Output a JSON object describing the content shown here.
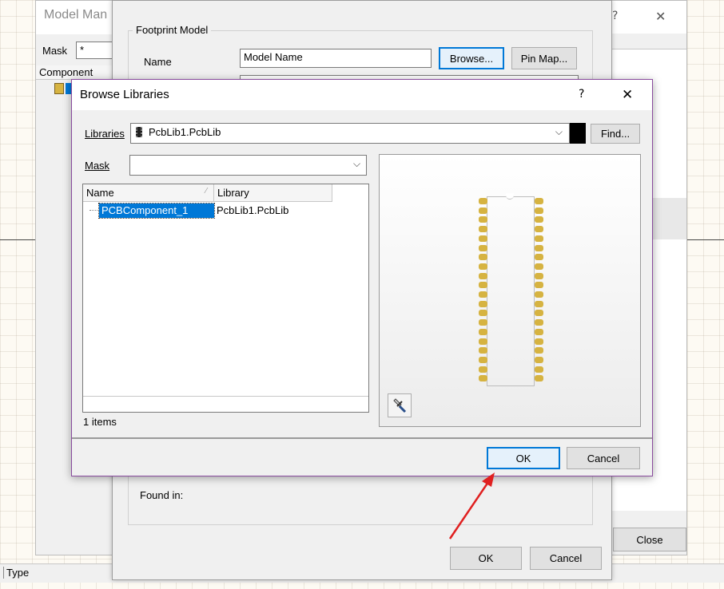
{
  "model_manager": {
    "title": "Model Man",
    "mask_label": "Mask",
    "mask_value": "*",
    "column_component": "Component",
    "help_glyph": "?",
    "close_glyph": "✕",
    "close_button": "Close",
    "status_type": "Type"
  },
  "footprint_dialog": {
    "group_title": "Footprint Model",
    "name_label": "Name",
    "name_value": "Model Name",
    "browse_button": "Browse...",
    "pinmap_button": "Pin Map...",
    "found_in_label": "Found in:",
    "ok_button": "OK",
    "cancel_button": "Cancel"
  },
  "browse_libraries": {
    "title": "Browse Libraries",
    "help_glyph": "?",
    "close_glyph": "✕",
    "libraries_label": "Libraries",
    "library_selected": "PcbLib1.PcbLib",
    "find_button": "Find...",
    "mask_label": "Mask",
    "mask_value": "",
    "columns": {
      "name": "Name",
      "library": "Library"
    },
    "rows": [
      {
        "name": "PCBComponent_1",
        "library": "PcbLib1.PcbLib"
      }
    ],
    "item_count": "1 items",
    "ok_button": "OK",
    "cancel_button": "Cancel"
  },
  "colors": {
    "selection": "#0078d7",
    "pad": "#d6b341",
    "annotation_arrow": "#e02020",
    "dialog_border": "#8a4b9e"
  }
}
